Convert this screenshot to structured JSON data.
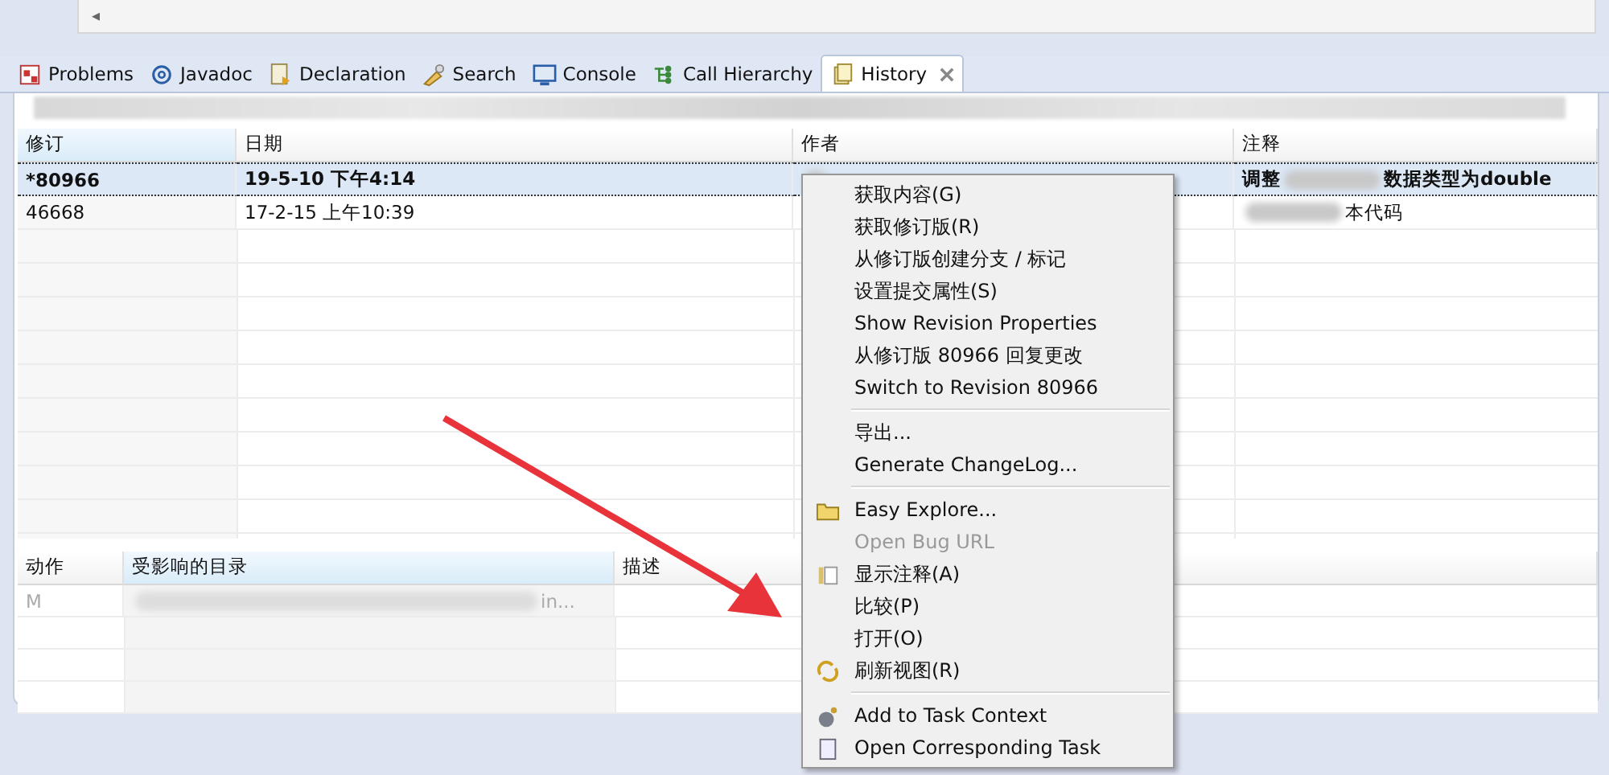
{
  "top_strip": {
    "scroll_arrow": "◂"
  },
  "tabs": [
    {
      "label": "Problems",
      "selected": false,
      "closable": false
    },
    {
      "label": "Javadoc",
      "selected": false,
      "closable": false
    },
    {
      "label": "Declaration",
      "selected": false,
      "closable": false
    },
    {
      "label": "Search",
      "selected": false,
      "closable": false
    },
    {
      "label": "Console",
      "selected": false,
      "closable": false
    },
    {
      "label": "Call Hierarchy",
      "selected": false,
      "closable": false
    },
    {
      "label": "History",
      "selected": true,
      "closable": true
    }
  ],
  "history_table": {
    "columns": [
      "修订",
      "日期",
      "作者",
      "注释"
    ],
    "rows": [
      {
        "revision": "*80966",
        "date": "19-5-10 下午4:14",
        "comment_parts": [
          "调整",
          "数据类型为double"
        ],
        "selected": true
      },
      {
        "revision": "46668",
        "date": "17-2-15 上午10:39",
        "comment_parts": [
          "本代码"
        ],
        "selected": false
      }
    ]
  },
  "paths_table": {
    "columns": [
      "动作",
      "受影响的目录",
      "描述"
    ],
    "rows": [
      {
        "action": "M",
        "path_tail": "in..."
      }
    ]
  },
  "context_menu": {
    "groups": [
      [
        {
          "label": "获取内容(G)",
          "disabled": false
        },
        {
          "label": "获取修订版(R)",
          "disabled": false
        },
        {
          "label": "从修订版创建分支 / 标记",
          "disabled": false
        },
        {
          "label": "设置提交属性(S)",
          "disabled": false
        },
        {
          "label": "Show Revision Properties",
          "disabled": false
        },
        {
          "label": "从修订版 80966 回复更改",
          "disabled": false
        },
        {
          "label": "Switch to Revision 80966",
          "disabled": false
        }
      ],
      [
        {
          "label": "导出...",
          "disabled": false
        },
        {
          "label": "Generate ChangeLog...",
          "disabled": false
        }
      ],
      [
        {
          "label": "Easy Explore...",
          "disabled": false
        },
        {
          "label": "Open Bug URL",
          "disabled": true
        },
        {
          "label": "显示注释(A)",
          "disabled": false
        },
        {
          "label": "比较(P)",
          "disabled": false
        },
        {
          "label": "打开(O)",
          "disabled": false
        },
        {
          "label": "刷新视图(R)",
          "disabled": false
        }
      ],
      [
        {
          "label": "Add to Task Context",
          "disabled": false
        },
        {
          "label": "Open Corresponding Task",
          "disabled": false
        }
      ]
    ]
  }
}
